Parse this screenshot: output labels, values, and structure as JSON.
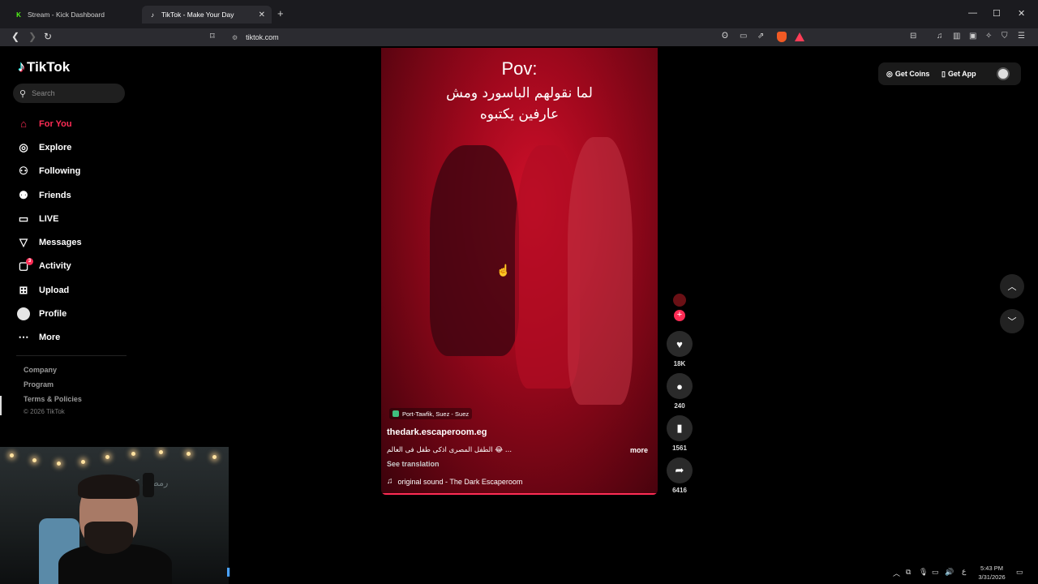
{
  "browser": {
    "tabs": [
      {
        "title": "Stream - Kick Dashboard",
        "active": false
      },
      {
        "title": "TikTok - Make Your Day",
        "active": true
      }
    ],
    "url": "tiktok.com"
  },
  "sidebar": {
    "logo": "TikTok",
    "search_placeholder": "Search",
    "items": [
      {
        "label": "For You",
        "icon": "home-icon",
        "active": true
      },
      {
        "label": "Explore",
        "icon": "compass-icon"
      },
      {
        "label": "Following",
        "icon": "following-icon"
      },
      {
        "label": "Friends",
        "icon": "friends-icon"
      },
      {
        "label": "LIVE",
        "icon": "live-icon"
      },
      {
        "label": "Messages",
        "icon": "messages-icon"
      },
      {
        "label": "Activity",
        "icon": "activity-icon",
        "badge": "3"
      },
      {
        "label": "Upload",
        "icon": "upload-icon"
      },
      {
        "label": "Profile",
        "icon": "avatar"
      },
      {
        "label": "More",
        "icon": "more-icon"
      }
    ],
    "footer": {
      "company": "Company",
      "program": "Program",
      "terms": "Terms & Policies",
      "copyright": "© 2026 TikTok"
    }
  },
  "video": {
    "overlay_title": "Pov:",
    "overlay_text_line1": "لما نقولهم الباسورد ومش",
    "overlay_text_line2": "عارفين يكتبوه",
    "location": "Port-Tawfik, Suez - Suez",
    "author": "thedark.escaperoom.eg",
    "caption": "الطفل المصرى اذكى طفل فى العالم 😂 ...",
    "more_label": "more",
    "see_translation": "See translation",
    "sound": "original sound - The Dark Escaperoom"
  },
  "actions": {
    "likes": "18K",
    "comments": "240",
    "saves": "1561",
    "shares": "6416"
  },
  "header": {
    "get_coins": "Get Coins",
    "get_app": "Get App"
  },
  "taskbar": {
    "lang": "ع",
    "time": "5:43 PM",
    "date": "3/31/2026"
  },
  "webcam": {
    "wall_text": "رمضان كريم"
  },
  "colors": {
    "accent": "#fe2c55",
    "background": "#000000"
  }
}
